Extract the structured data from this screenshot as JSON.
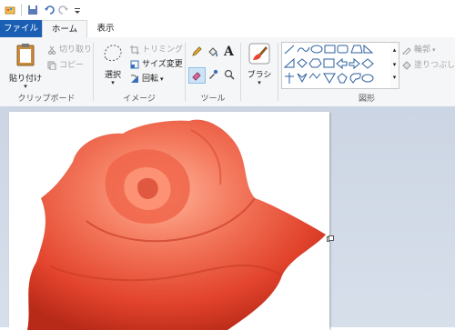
{
  "tabs": {
    "file": "ファイル",
    "home": "ホーム",
    "view": "表示"
  },
  "clipboard": {
    "paste": "貼り付け",
    "cut": "切り取り",
    "copy": "コピー",
    "label": "クリップボード"
  },
  "image": {
    "select": "選択",
    "crop": "トリミング",
    "resize": "サイズ変更",
    "rotate": "回転",
    "label": "イメージ"
  },
  "tools": {
    "label": "ツール"
  },
  "brush": {
    "label": "ブラシ"
  },
  "shapes": {
    "outline": "輪郭",
    "fill": "塗りつぶし",
    "label": "図形",
    "text_tool": "A"
  },
  "colors": {
    "accent": "#1a5fb4",
    "rose": "#e8452f"
  }
}
